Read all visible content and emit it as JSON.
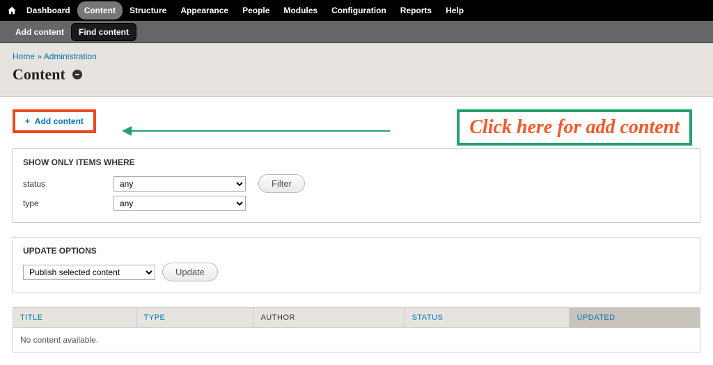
{
  "toolbar": {
    "items": [
      {
        "label": "Dashboard",
        "active": false
      },
      {
        "label": "Content",
        "active": true
      },
      {
        "label": "Structure",
        "active": false
      },
      {
        "label": "Appearance",
        "active": false
      },
      {
        "label": "People",
        "active": false
      },
      {
        "label": "Modules",
        "active": false
      },
      {
        "label": "Configuration",
        "active": false
      },
      {
        "label": "Reports",
        "active": false
      },
      {
        "label": "Help",
        "active": false
      }
    ]
  },
  "subtoolbar": {
    "add_label": "Add content",
    "find_label": "Find content"
  },
  "breadcrumb": {
    "home": "Home",
    "sep": "»",
    "admin": "Administration"
  },
  "page_title": "Content",
  "add_link": "Add content",
  "callout_text": "Click here for add content",
  "filter_box": {
    "legend": "SHOW ONLY ITEMS WHERE",
    "status_label": "status",
    "status_value": "any",
    "type_label": "type",
    "type_value": "any",
    "filter_button": "Filter"
  },
  "update_box": {
    "legend": "UPDATE OPTIONS",
    "operation_value": "Publish selected content",
    "update_button": "Update"
  },
  "table": {
    "headers": {
      "title": "TITLE",
      "type": "TYPE",
      "author": "AUTHOR",
      "status": "STATUS",
      "updated": "UPDATED"
    },
    "empty": "No content available."
  }
}
